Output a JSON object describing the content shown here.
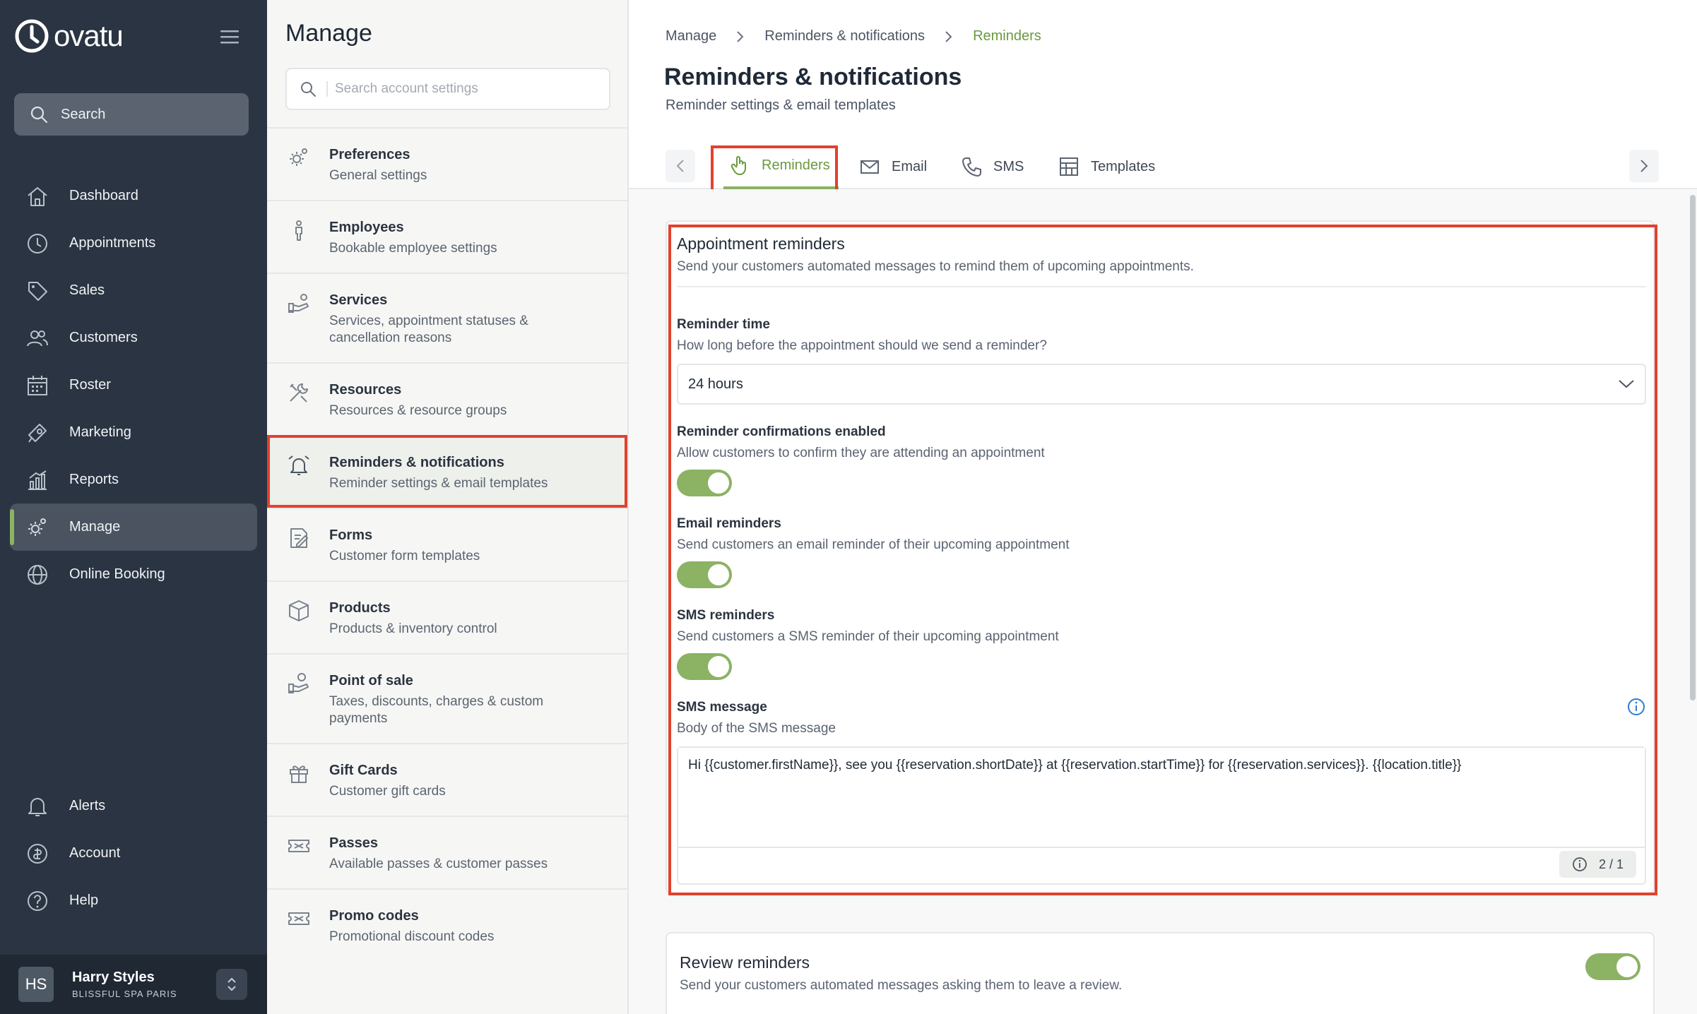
{
  "app": {
    "brand": "ovatu"
  },
  "sidebar": {
    "search_label": "Search",
    "items": [
      {
        "label": "Dashboard",
        "icon": "home-icon"
      },
      {
        "label": "Appointments",
        "icon": "clock-icon"
      },
      {
        "label": "Sales",
        "icon": "tag-icon"
      },
      {
        "label": "Customers",
        "icon": "users-icon"
      },
      {
        "label": "Roster",
        "icon": "calendar-icon"
      },
      {
        "label": "Marketing",
        "icon": "megaphone-icon"
      },
      {
        "label": "Reports",
        "icon": "chart-icon"
      },
      {
        "label": "Manage",
        "icon": "gear-icon",
        "active": true
      },
      {
        "label": "Online Booking",
        "icon": "globe-icon"
      }
    ],
    "bottom_items": [
      {
        "label": "Alerts",
        "icon": "bell-icon"
      },
      {
        "label": "Account",
        "icon": "account-icon"
      },
      {
        "label": "Help",
        "icon": "help-icon"
      }
    ],
    "user": {
      "initials": "HS",
      "name": "Harry Styles",
      "org": "BLISSFUL SPA PARIS"
    }
  },
  "manage": {
    "title": "Manage",
    "search_placeholder": "Search account settings",
    "items": [
      {
        "title": "Preferences",
        "sub": "General settings",
        "icon": "gear-icon"
      },
      {
        "title": "Employees",
        "sub": "Bookable employee settings",
        "icon": "person-icon"
      },
      {
        "title": "Services",
        "sub": "Services, appointment statuses & cancellation reasons",
        "icon": "services-icon"
      },
      {
        "title": "Resources",
        "sub": "Resources & resource groups",
        "icon": "tools-icon"
      },
      {
        "title": "Reminders & notifications",
        "sub": "Reminder settings & email templates",
        "icon": "alarm-icon",
        "active": true
      },
      {
        "title": "Forms",
        "sub": "Customer form templates",
        "icon": "form-icon"
      },
      {
        "title": "Products",
        "sub": "Products & inventory control",
        "icon": "box-icon"
      },
      {
        "title": "Point of sale",
        "sub": "Taxes, discounts, charges & custom payments",
        "icon": "pos-icon"
      },
      {
        "title": "Gift Cards",
        "sub": "Customer gift cards",
        "icon": "gift-icon"
      },
      {
        "title": "Passes",
        "sub": "Available passes & customer passes",
        "icon": "ticket-icon"
      },
      {
        "title": "Promo codes",
        "sub": "Promotional discount codes",
        "icon": "ticket-icon"
      }
    ]
  },
  "main": {
    "breadcrumb": [
      "Manage",
      "Reminders & notifications",
      "Reminders"
    ],
    "title": "Reminders & notifications",
    "subtitle": "Reminder settings & email templates",
    "tabs": [
      {
        "label": "Reminders",
        "icon": "hand-icon",
        "active": true
      },
      {
        "label": "Email",
        "icon": "mail-icon"
      },
      {
        "label": "SMS",
        "icon": "phone-icon"
      },
      {
        "label": "Templates",
        "icon": "template-icon"
      }
    ],
    "appointment": {
      "title": "Appointment reminders",
      "desc": "Send your customers automated messages to remind them of upcoming appointments.",
      "reminder_time_label": "Reminder time",
      "reminder_time_desc": "How long before the appointment should we send a reminder?",
      "reminder_time_value": "24 hours",
      "confirm_label": "Reminder confirmations enabled",
      "confirm_desc": "Allow customers to confirm they are attending an appointment",
      "confirm_on": true,
      "email_label": "Email reminders",
      "email_desc": "Send customers an email reminder of their upcoming appointment",
      "email_on": true,
      "sms_label": "SMS reminders",
      "sms_desc": "Send customers a SMS reminder of their upcoming appointment",
      "sms_on": true,
      "sms_message_label": "SMS message",
      "sms_message_desc": "Body of the SMS message",
      "sms_message_value": "Hi {{customer.firstName}}, see you {{reservation.shortDate}} at {{reservation.startTime}} for {{reservation.services}}. {{location.title}}",
      "sms_counter": "2 / 1"
    },
    "review": {
      "title": "Review reminders",
      "desc": "Send your customers automated messages asking them to leave a review.",
      "on": true
    }
  },
  "colors": {
    "accent": "#8cb264",
    "highlight": "#e2412d",
    "sidebar_bg": "#2a3442"
  }
}
